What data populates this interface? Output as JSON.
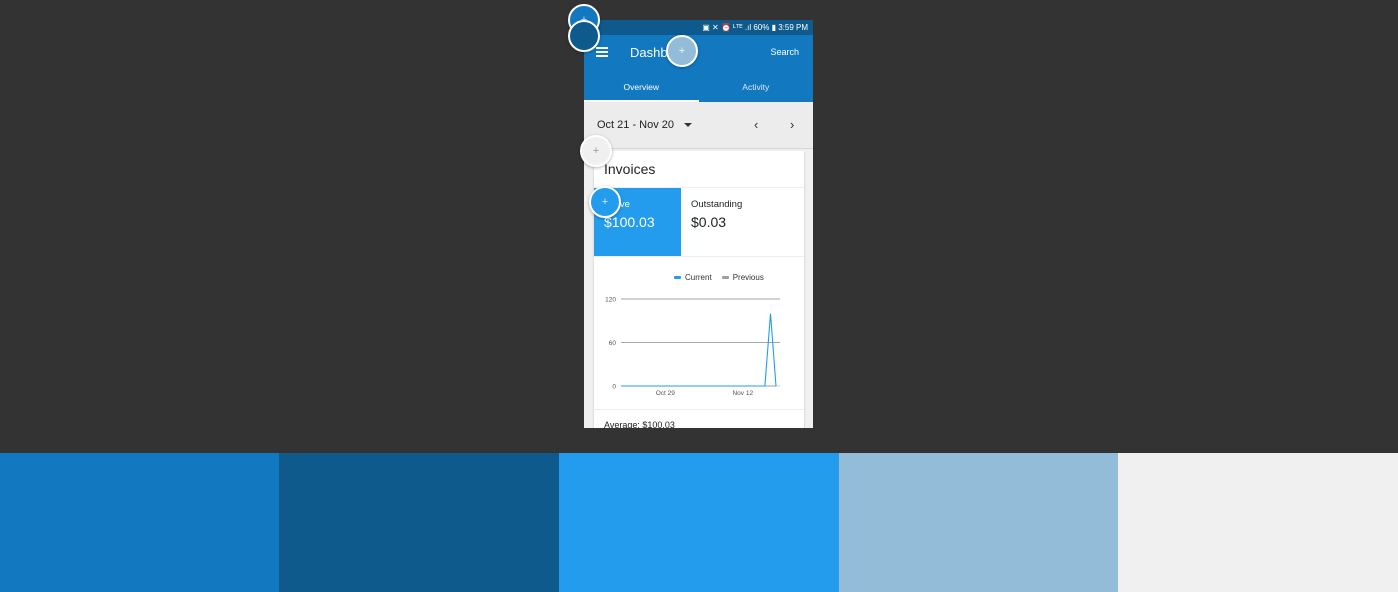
{
  "status_bar": {
    "text": "▣ ✕ ⏰ ᴸᵀᴱ .ıl 60% ▮ 3:59 PM"
  },
  "app_bar": {
    "title": "Dashboard",
    "search_label": "Search"
  },
  "tabs": [
    {
      "label": "Overview",
      "active": true
    },
    {
      "label": "Activity",
      "active": false
    }
  ],
  "date_bar": {
    "range": "Oct 21 - Nov 20",
    "prev": "‹",
    "next": "›"
  },
  "card": {
    "title": "Invoices",
    "kpis": [
      {
        "label": "Active",
        "value": "$100.03"
      },
      {
        "label": "Outstanding",
        "value": "$0.03"
      }
    ],
    "average": "Average: $100.03"
  },
  "chart_data": {
    "type": "line",
    "series": [
      {
        "name": "Current",
        "color": "#239cee",
        "x": [
          "Oct 21",
          "Oct 29",
          "Nov 5",
          "Nov 12",
          "Nov 15",
          "Nov 16",
          "Nov 17",
          "Nov 18"
        ],
        "values": [
          0,
          0,
          0,
          0,
          0,
          0,
          100,
          0
        ]
      },
      {
        "name": "Previous",
        "color": "#9e9e9e",
        "x": [
          "Oct 21",
          "Nov 18"
        ],
        "values": [
          0,
          0
        ]
      }
    ],
    "x_ticks": [
      "Oct 29",
      "Nov 12"
    ],
    "y_ticks": [
      "0",
      "60",
      "120"
    ],
    "ylim": [
      0,
      120
    ],
    "legend": "top-right",
    "grid": true
  },
  "touch_points": [
    {
      "color": "#1279c1",
      "glyph": "+"
    },
    {
      "color": "#0e5a8c",
      "glyph": ""
    },
    {
      "color": "#92bcd8",
      "glyph": "+"
    },
    {
      "color": "#f0f0f0",
      "glyph": "+"
    },
    {
      "color": "#239cee",
      "glyph": "+"
    }
  ],
  "palette": [
    "#1279c1",
    "#0e5a8c",
    "#239cee",
    "#92bcd8",
    "#f0f0f0"
  ]
}
